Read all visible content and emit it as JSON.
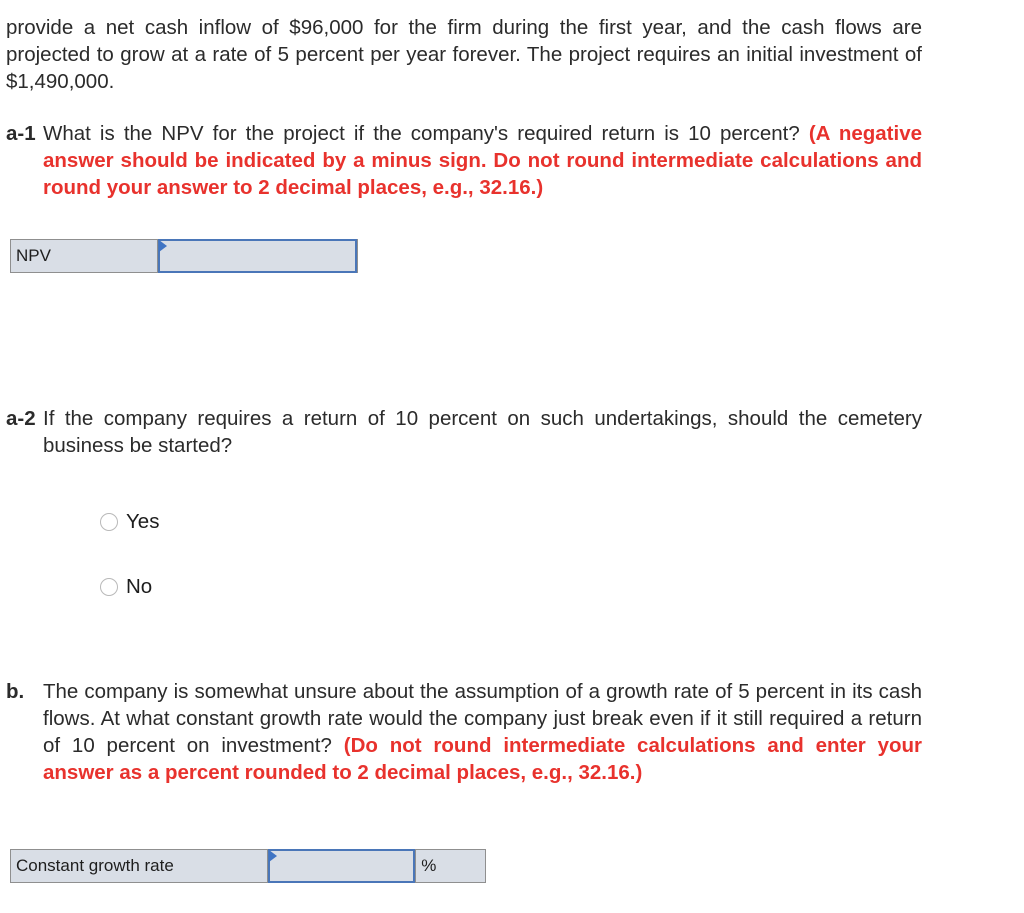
{
  "intro": {
    "text": "provide a net cash inflow of $96,000 for the firm during the first year, and the cash flows are projected to grow at a rate of 5 percent per year forever. The project requires an initial investment of $1,490,000."
  },
  "questions": {
    "a1": {
      "number": "a-1",
      "text": "What is the NPV for the project if the company's required return is 10 percent?",
      "instruction": "(A negative answer should be indicated by a minus sign. Do not round intermediate calculations and round your answer to 2 decimal places, e.g., 32.16.)",
      "answer_table": {
        "label": "NPV",
        "value": "",
        "placeholder": ""
      }
    },
    "a2": {
      "number": "a-2",
      "text": "If the company requires a return of 10 percent on such undertakings, should the cemetery business be started?",
      "options": [
        {
          "label": "Yes",
          "selected": false
        },
        {
          "label": "No",
          "selected": false
        }
      ]
    },
    "b": {
      "number": "b.",
      "text": "The company is somewhat unsure about the assumption of a growth rate of 5 percent in its cash flows. At what constant growth rate would the company just break even if it still required a return of 10 percent on investment?",
      "instruction": "(Do not round intermediate calculations and enter your answer as a percent rounded to 2 decimal places, e.g., 32.16.)",
      "answer_table": {
        "label": "Constant growth rate",
        "value": "",
        "placeholder": "",
        "unit": "%"
      }
    }
  },
  "colors": {
    "instruction_red": "#e8322d",
    "input_border_blue": "#4a76b8",
    "table_bg": "#d9dee6"
  }
}
